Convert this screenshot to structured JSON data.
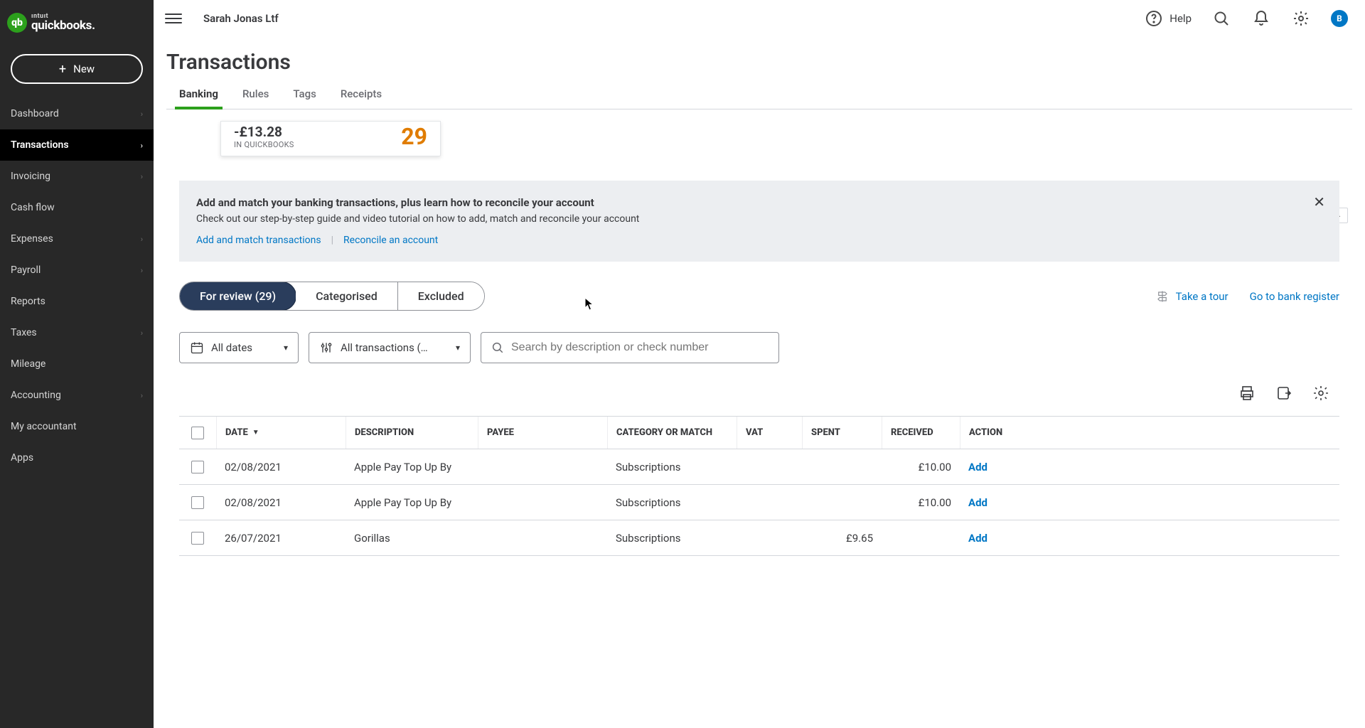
{
  "brand": {
    "intuit": "ıntuıt",
    "product": "quickbooks."
  },
  "new_button": {
    "label": "New"
  },
  "nav": [
    {
      "label": "Dashboard",
      "chev": true
    },
    {
      "label": "Transactions",
      "chev": true,
      "active": true
    },
    {
      "label": "Invoicing",
      "chev": true
    },
    {
      "label": "Cash flow"
    },
    {
      "label": "Expenses",
      "chev": true
    },
    {
      "label": "Payroll",
      "chev": true
    },
    {
      "label": "Reports"
    },
    {
      "label": "Taxes",
      "chev": true
    },
    {
      "label": "Mileage"
    },
    {
      "label": "Accounting",
      "chev": true
    },
    {
      "label": "My accountant"
    },
    {
      "label": "Apps"
    }
  ],
  "company": "Sarah Jonas Ltf",
  "help": "Help",
  "avatar": "B",
  "page_title": "Transactions",
  "tabs": [
    {
      "label": "Banking",
      "active": true
    },
    {
      "label": "Rules"
    },
    {
      "label": "Tags"
    },
    {
      "label": "Receipts"
    }
  ],
  "balance": {
    "amount": "-£13.28",
    "label": "IN QUICKBOOKS",
    "count": "29"
  },
  "info": {
    "title": "Add and match your banking transactions, plus learn how to reconcile your account",
    "subtitle": "Check out our step-by-step guide and video tutorial on how to add, match and reconcile your account",
    "link1": "Add and match transactions",
    "link2": "Reconcile an account"
  },
  "segments": {
    "for_review": "For review (29)",
    "categorised": "Categorised",
    "excluded": "Excluded"
  },
  "tour_link": "Take a tour",
  "register_link": "Go to bank register",
  "date_filter": "All dates",
  "txn_filter": "All transactions (…",
  "search_placeholder": "Search by description or check number",
  "columns": {
    "date": "DATE",
    "description": "DESCRIPTION",
    "payee": "PAYEE",
    "category": "CATEGORY OR MATCH",
    "vat": "VAT",
    "spent": "SPENT",
    "received": "RECEIVED",
    "action": "ACTION"
  },
  "rows": [
    {
      "date": "02/08/2021",
      "description": "Apple Pay Top Up By",
      "payee": "",
      "category": "Subscriptions",
      "vat": "",
      "spent": "",
      "received": "£10.00",
      "action": "Add"
    },
    {
      "date": "02/08/2021",
      "description": "Apple Pay Top Up By",
      "payee": "",
      "category": "Subscriptions",
      "vat": "",
      "spent": "",
      "received": "£10.00",
      "action": "Add"
    },
    {
      "date": "26/07/2021",
      "description": "Gorillas",
      "payee": "",
      "category": "Subscriptions",
      "vat": "",
      "spent": "£9.65",
      "received": "",
      "action": "Add"
    }
  ]
}
